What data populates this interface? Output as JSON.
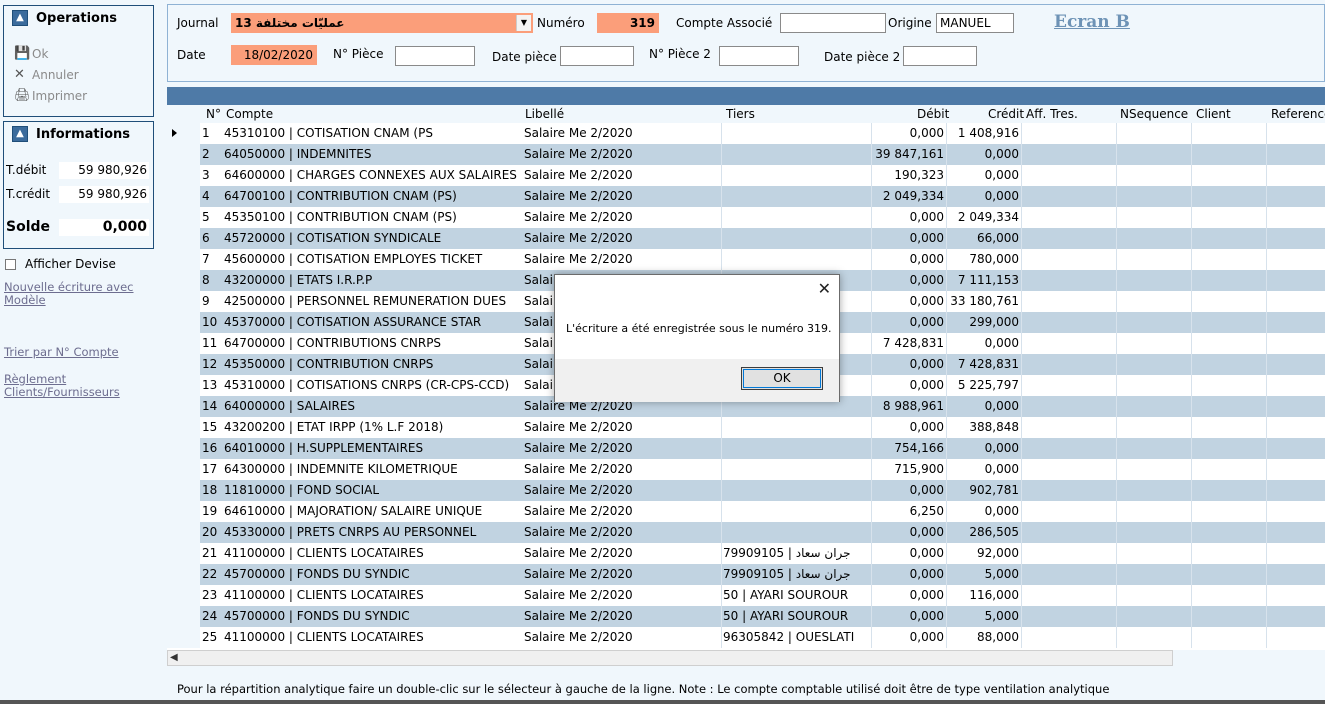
{
  "sidebar": {
    "operations_title": "Operations",
    "operations": [
      {
        "label": "Ok",
        "icon": "save-icon"
      },
      {
        "label": "Annuler",
        "icon": "cancel-icon"
      },
      {
        "label": "Imprimer",
        "icon": "printer-icon"
      }
    ],
    "informations_title": "Informations",
    "t_debit_label": "T.débit",
    "t_debit_value": "59 980,926",
    "t_credit_label": "T.crédit",
    "t_credit_value": "59 980,926",
    "solde_label": "Solde",
    "solde_value": "0,000",
    "afficher_devise": "Afficher Devise",
    "afficher_devise_checked": false,
    "links": {
      "nouvelle_line1": "Nouvelle écriture avec",
      "nouvelle_line2": "Modèle",
      "trier": "Trier par N° Compte",
      "reglement_line1": "Règlement",
      "reglement_line2": "Clients/Fournisseurs"
    }
  },
  "form": {
    "journal_label": "Journal",
    "journal_value": "13  عمليّات مختلفة",
    "numero_label": "Numéro",
    "numero_value": "319",
    "compte_associe_label": "Compte Associé",
    "compte_associe_value": "",
    "origine_label": "Origine",
    "origine_value": "MANUEL",
    "ecran_link": "Ecran B",
    "date_label": "Date",
    "date_value": "18/02/2020",
    "piece_label": "N° Pièce",
    "piece_value": "",
    "date_piece_label": "Date pièce",
    "date_piece_value": "",
    "piece2_label": "N° Pièce 2",
    "piece2_value": "",
    "date_piece2_label": "Date pièce 2",
    "date_piece2_value": ""
  },
  "grid": {
    "columns": [
      "N°",
      "Compte",
      "Libellé",
      "Tiers",
      "Débit",
      "Crédit",
      "Aff. Tres.",
      "NSequence",
      "Client",
      "Reference"
    ],
    "rows": [
      {
        "n": "1",
        "compte": "45310100 | COTISATION CNAM (PS",
        "libelle": "Salaire Me 2/2020",
        "tiers": "",
        "debit": "0,000",
        "credit": "1 408,916"
      },
      {
        "n": "2",
        "compte": "64050000 | INDEMNITES",
        "libelle": "Salaire Me 2/2020",
        "tiers": "",
        "debit": "39 847,161",
        "credit": "0,000"
      },
      {
        "n": "3",
        "compte": "64600000 | CHARGES CONNEXES AUX SALAIRES",
        "libelle": "Salaire Me 2/2020",
        "tiers": "",
        "debit": "190,323",
        "credit": "0,000"
      },
      {
        "n": "4",
        "compte": "64700100 | CONTRIBUTION CNAM (PS)",
        "libelle": "Salaire Me 2/2020",
        "tiers": "",
        "debit": "2 049,334",
        "credit": "0,000"
      },
      {
        "n": "5",
        "compte": "45350100 | CONTRIBUTION CNAM (PS)",
        "libelle": "Salaire Me 2/2020",
        "tiers": "",
        "debit": "0,000",
        "credit": "2 049,334"
      },
      {
        "n": "6",
        "compte": "45720000 | COTISATION SYNDICALE",
        "libelle": "Salaire Me 2/2020",
        "tiers": "",
        "debit": "0,000",
        "credit": "66,000"
      },
      {
        "n": "7",
        "compte": "45600000 | COTISATION EMPLOYES TICKET",
        "libelle": "Salaire Me 2/2020",
        "tiers": "",
        "debit": "0,000",
        "credit": "780,000"
      },
      {
        "n": "8",
        "compte": "43200000 | ETATS I.R.P.P",
        "libelle": "Salai",
        "tiers": "",
        "debit": "0,000",
        "credit": "7 111,153"
      },
      {
        "n": "9",
        "compte": "42500000 | PERSONNEL REMUNERATION DUES",
        "libelle": "Salai",
        "tiers": "",
        "debit": "0,000",
        "credit": "33 180,761"
      },
      {
        "n": "10",
        "compte": "45370000 | COTISATION ASSURANCE STAR",
        "libelle": "Salai",
        "tiers": "",
        "debit": "0,000",
        "credit": "299,000"
      },
      {
        "n": "11",
        "compte": "64700000 | CONTRIBUTIONS CNRPS",
        "libelle": "Salai",
        "tiers": "",
        "debit": "7 428,831",
        "credit": "0,000"
      },
      {
        "n": "12",
        "compte": "45350000 | CONTRIBUTION CNRPS",
        "libelle": "Salai",
        "tiers": "",
        "debit": "0,000",
        "credit": "7 428,831"
      },
      {
        "n": "13",
        "compte": "45310000 | COTISATIONS CNRPS (CR-CPS-CCD)",
        "libelle": "Salai",
        "tiers": "",
        "debit": "0,000",
        "credit": "5 225,797"
      },
      {
        "n": "14",
        "compte": "64000000 | SALAIRES",
        "libelle": "Salaire Me 2/2020",
        "tiers": "",
        "debit": "8 988,961",
        "credit": "0,000"
      },
      {
        "n": "15",
        "compte": "43200200 | ETAT IRPP (1% L.F 2018)",
        "libelle": "Salaire Me 2/2020",
        "tiers": "",
        "debit": "0,000",
        "credit": "388,848"
      },
      {
        "n": "16",
        "compte": "64010000 | H.SUPPLEMENTAIRES",
        "libelle": "Salaire Me 2/2020",
        "tiers": "",
        "debit": "754,166",
        "credit": "0,000"
      },
      {
        "n": "17",
        "compte": "64300000 | INDEMNITE KILOMETRIQUE",
        "libelle": "Salaire Me 2/2020",
        "tiers": "",
        "debit": "715,900",
        "credit": "0,000"
      },
      {
        "n": "18",
        "compte": "11810000 | FOND SOCIAL",
        "libelle": "Salaire Me 2/2020",
        "tiers": "",
        "debit": "0,000",
        "credit": "902,781"
      },
      {
        "n": "19",
        "compte": "64610000 | MAJORATION/ SALAIRE UNIQUE",
        "libelle": "Salaire Me 2/2020",
        "tiers": "",
        "debit": "6,250",
        "credit": "0,000"
      },
      {
        "n": "20",
        "compte": "45330000 | PRETS CNRPS AU PERSONNEL",
        "libelle": "Salaire Me 2/2020",
        "tiers": "",
        "debit": "0,000",
        "credit": "286,505"
      },
      {
        "n": "21",
        "compte": "41100000 | CLIENTS LOCATAIRES",
        "libelle": "Salaire Me 2/2020",
        "tiers": "79909105 | جران سعاد",
        "debit": "0,000",
        "credit": "92,000"
      },
      {
        "n": "22",
        "compte": "45700000 | FONDS DU SYNDIC",
        "libelle": "Salaire Me 2/2020",
        "tiers": "79909105 | جران سعاد",
        "debit": "0,000",
        "credit": "5,000"
      },
      {
        "n": "23",
        "compte": "41100000 | CLIENTS LOCATAIRES",
        "libelle": "Salaire Me 2/2020",
        "tiers": "50 | AYARI SOUROUR",
        "debit": "0,000",
        "credit": "116,000"
      },
      {
        "n": "24",
        "compte": "45700000 | FONDS DU SYNDIC",
        "libelle": "Salaire Me 2/2020",
        "tiers": "50 | AYARI SOUROUR",
        "debit": "0,000",
        "credit": "5,000"
      },
      {
        "n": "25",
        "compte": "41100000 | CLIENTS LOCATAIRES",
        "libelle": "Salaire Me 2/2020",
        "tiers": "96305842 | OUESLATI",
        "debit": "0,000",
        "credit": "88,000"
      }
    ]
  },
  "footer_note": "Pour la répartition analytique faire un double-clic sur le sélecteur à gauche de la ligne. Note : Le compte comptable utilisé doit être de type ventilation analytique",
  "dialog": {
    "message": "L'écriture a été enregistrée sous le numéro 319.",
    "ok_label": "OK"
  }
}
